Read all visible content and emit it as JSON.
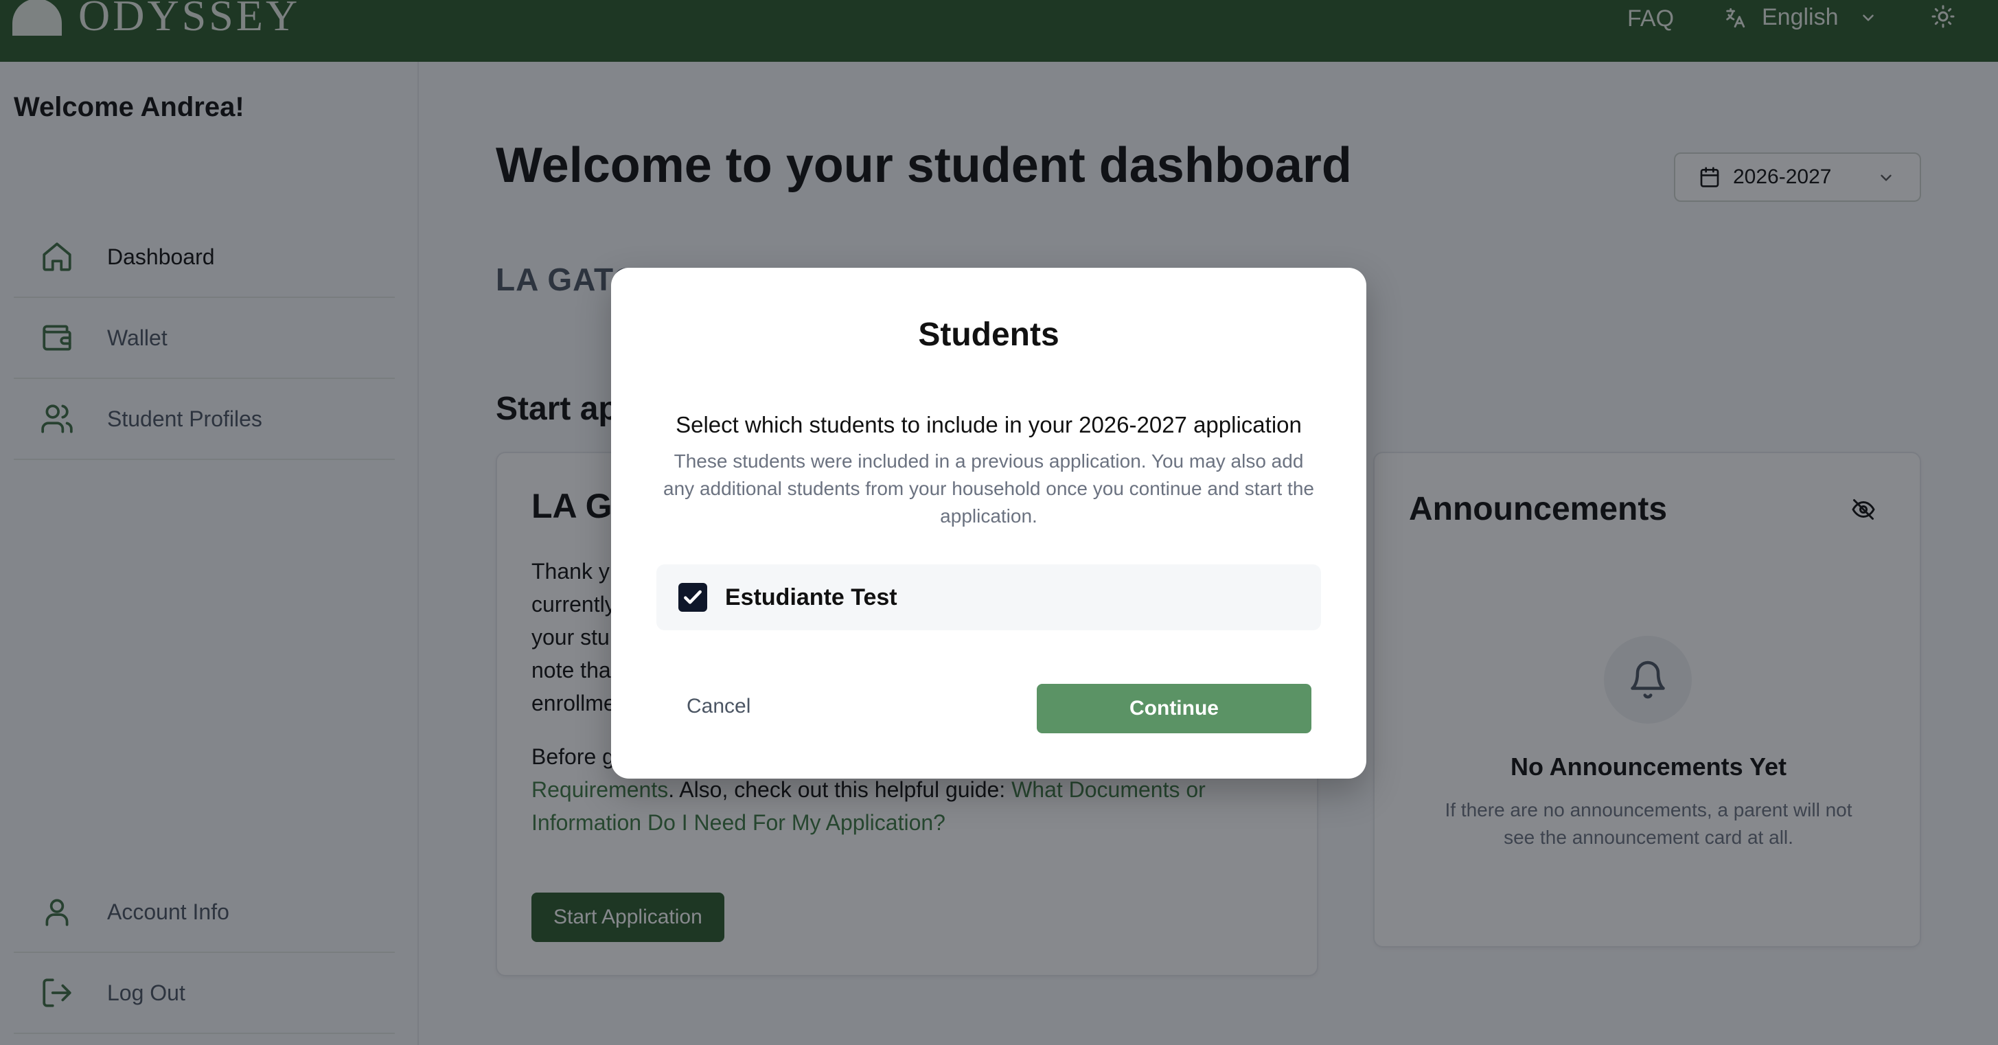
{
  "header": {
    "logo_text": "ODYSSEY",
    "faq": "FAQ",
    "language": "English"
  },
  "sidebar": {
    "welcome": "Welcome Andrea!",
    "items": [
      {
        "label": "Dashboard",
        "icon": "home-icon",
        "active": true
      },
      {
        "label": "Wallet",
        "icon": "wallet-icon"
      },
      {
        "label": "Student Profiles",
        "icon": "users-icon"
      }
    ],
    "bottom_items": [
      {
        "label": "Account Info",
        "icon": "user-icon"
      },
      {
        "label": "Log Out",
        "icon": "logout-icon"
      }
    ]
  },
  "main": {
    "title": "Welcome to your student dashboard",
    "year_select": "2026-2027",
    "district": "LA GATO",
    "start_heading": "Start ap",
    "app_card": {
      "title": "LA GA",
      "body_lines": [
        "Thank y",
        "currently",
        "your stu",
        "note tha",
        "enrollme"
      ],
      "before_text": "Before g",
      "link1": "Requirements",
      "mid_text": ". Also, check out this helpful guide: ",
      "link2": "What Documents or Information Do I Need For My Application?",
      "start_button": "Start Application"
    },
    "announcements": {
      "title": "Announcements",
      "empty_title": "No Announcements Yet",
      "empty_text": "If there are no announcements, a parent will not see the announcement card at all."
    }
  },
  "modal": {
    "title": "Students",
    "subtitle": "Select which students to include in your 2026-2027 application",
    "description": "These students were included in a previous application. You may also add any additional students from your household once you continue and start the application.",
    "students": [
      {
        "name": "Estudiante Test",
        "checked": true
      }
    ],
    "cancel": "Cancel",
    "continue": "Continue"
  },
  "colors": {
    "brand_green": "#2c5a2d",
    "continue_green": "#5b9365",
    "link_green": "#3f7a44"
  }
}
